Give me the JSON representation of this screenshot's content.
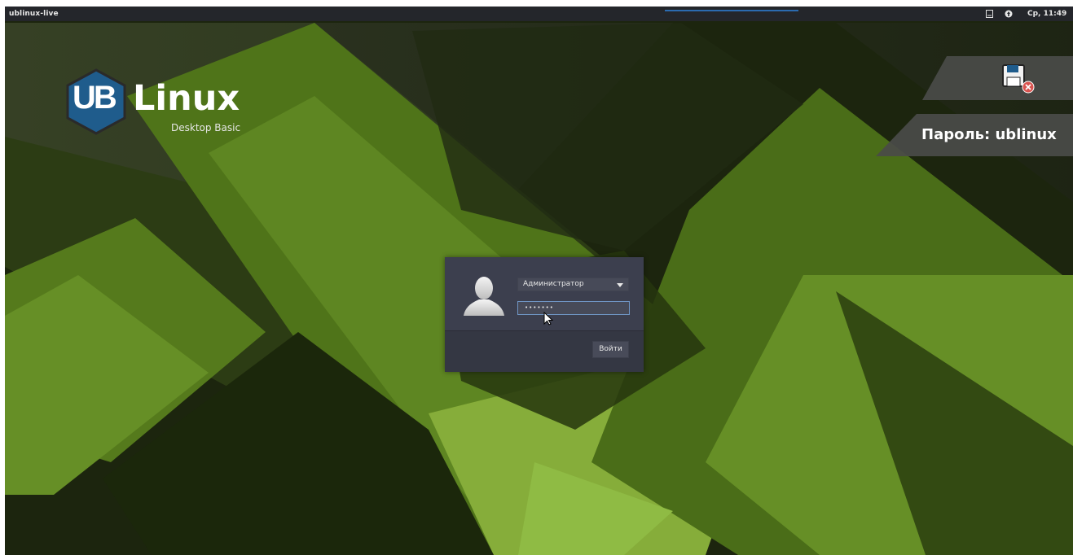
{
  "panel": {
    "hostname": "ublinux-live",
    "clock": "Ср, 11:49",
    "icons": [
      "notes-icon",
      "network-icon"
    ]
  },
  "logo": {
    "ub": "UB",
    "linux": "Linux",
    "edition": "Desktop Basic"
  },
  "hint": {
    "password_text": "Пароль: ublinux",
    "icon": "floppy-save-error-icon"
  },
  "login": {
    "selected_user": "Администратор",
    "password_mask": "•••••••",
    "login_button": "Войти",
    "avatar_icon": "user-silhouette-icon"
  },
  "colors": {
    "accent_blue": "#2b6bb0",
    "panel_bg": "#24262b",
    "dialog_bg": "#393c49",
    "logo_hex": "#1f5c8c",
    "wallpaper_green": "#5f8a22"
  }
}
